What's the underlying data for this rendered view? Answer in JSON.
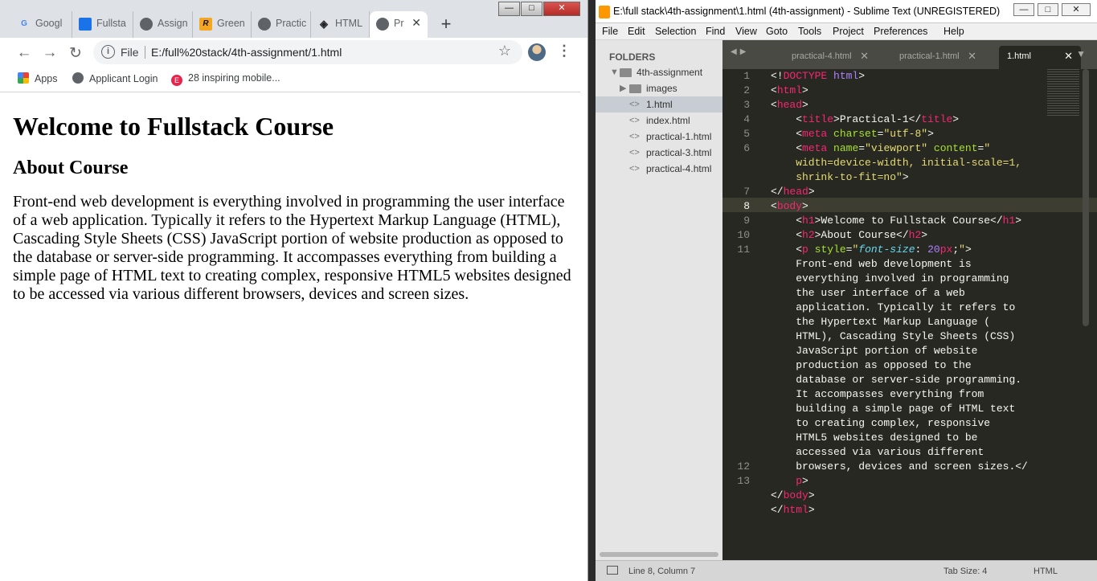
{
  "browser": {
    "window_controls": [
      "—",
      "□",
      "✕"
    ],
    "tabs": [
      {
        "label": "Googl",
        "icon": "google-icon",
        "icon_text": "G",
        "color": "#4285f4"
      },
      {
        "label": "Fullsta",
        "icon": "classroom-icon",
        "icon_text": "▣",
        "color": "#1a73e8"
      },
      {
        "label": "Assign",
        "icon": "globe-icon",
        "icon_text": "",
        "color": "#5f6368"
      },
      {
        "label": "Green",
        "icon": "r-logo-icon",
        "icon_text": "R",
        "color": "#f5a623"
      },
      {
        "label": "Practic",
        "icon": "globe-icon",
        "icon_text": "",
        "color": "#5f6368"
      },
      {
        "label": "HTML",
        "icon": "codepen-icon",
        "icon_text": "◈",
        "color": "#202124"
      },
      {
        "label": "Pr",
        "icon": "globe-icon",
        "icon_text": "",
        "color": "#5f6368",
        "active": true
      }
    ],
    "new_tab": "+",
    "omnibox": {
      "scheme": "File",
      "url": "E:/full%20stack/4th-assignment/1.html"
    },
    "bookmarks": [
      {
        "label": "Apps",
        "icon": "apps-grid-icon"
      },
      {
        "label": "Applicant Login",
        "icon": "globe-icon"
      },
      {
        "label": "28 inspiring mobile...",
        "icon": "e-logo-icon"
      }
    ]
  },
  "page": {
    "h1": "Welcome to Fullstack Course",
    "h2": "About Course",
    "paragraph": "Front-end web development is everything involved in programming the user interface of a web application. Typically it refers to the Hypertext Markup Language (HTML), Cascading Style Sheets (CSS) JavaScript portion of website production as opposed to the database or server-side programming. It accompasses everything from building a simple page of HTML text to creating complex, responsive HTML5 websites designed to be accessed via various different browsers, devices and screen sizes."
  },
  "editor": {
    "title": "E:\\full stack\\4th-assignment\\1.html (4th-assignment) - Sublime Text (UNREGISTERED)",
    "menu": [
      "File",
      "Edit",
      "Selection",
      "Find",
      "View",
      "Goto",
      "Tools",
      "Project",
      "Preferences",
      "Help"
    ],
    "folders_header": "FOLDERS",
    "tree": [
      {
        "label": "4th-assignment",
        "kind": "folder-open"
      },
      {
        "label": "images",
        "kind": "folder"
      },
      {
        "label": "1.html",
        "kind": "file",
        "selected": true
      },
      {
        "label": "index.html",
        "kind": "file"
      },
      {
        "label": "practical-1.html",
        "kind": "file"
      },
      {
        "label": "practical-3.html",
        "kind": "file"
      },
      {
        "label": "practical-4.html",
        "kind": "file"
      }
    ],
    "tabs": [
      {
        "label": "practical-4.html"
      },
      {
        "label": "practical-1.html"
      },
      {
        "label": "1.html",
        "active": true
      }
    ],
    "line_numbers": [
      "1",
      "2",
      "3",
      "4",
      "5",
      "6",
      "",
      "",
      "7",
      "8",
      "9",
      "10",
      "11",
      "",
      "",
      "",
      "",
      "",
      "",
      "",
      "",
      "",
      "",
      "",
      "",
      "",
      "",
      "12",
      "13"
    ],
    "current_line": 8,
    "status": {
      "position": "Line 8, Column 7",
      "tab_size": "Tab Size: 4",
      "syntax": "HTML"
    },
    "colors": {
      "bg": "#272822",
      "tag": "#f92672",
      "attr": "#a6e22e",
      "string": "#e6db74",
      "keyword": "#66d9ef",
      "number": "#ae81ff"
    }
  }
}
